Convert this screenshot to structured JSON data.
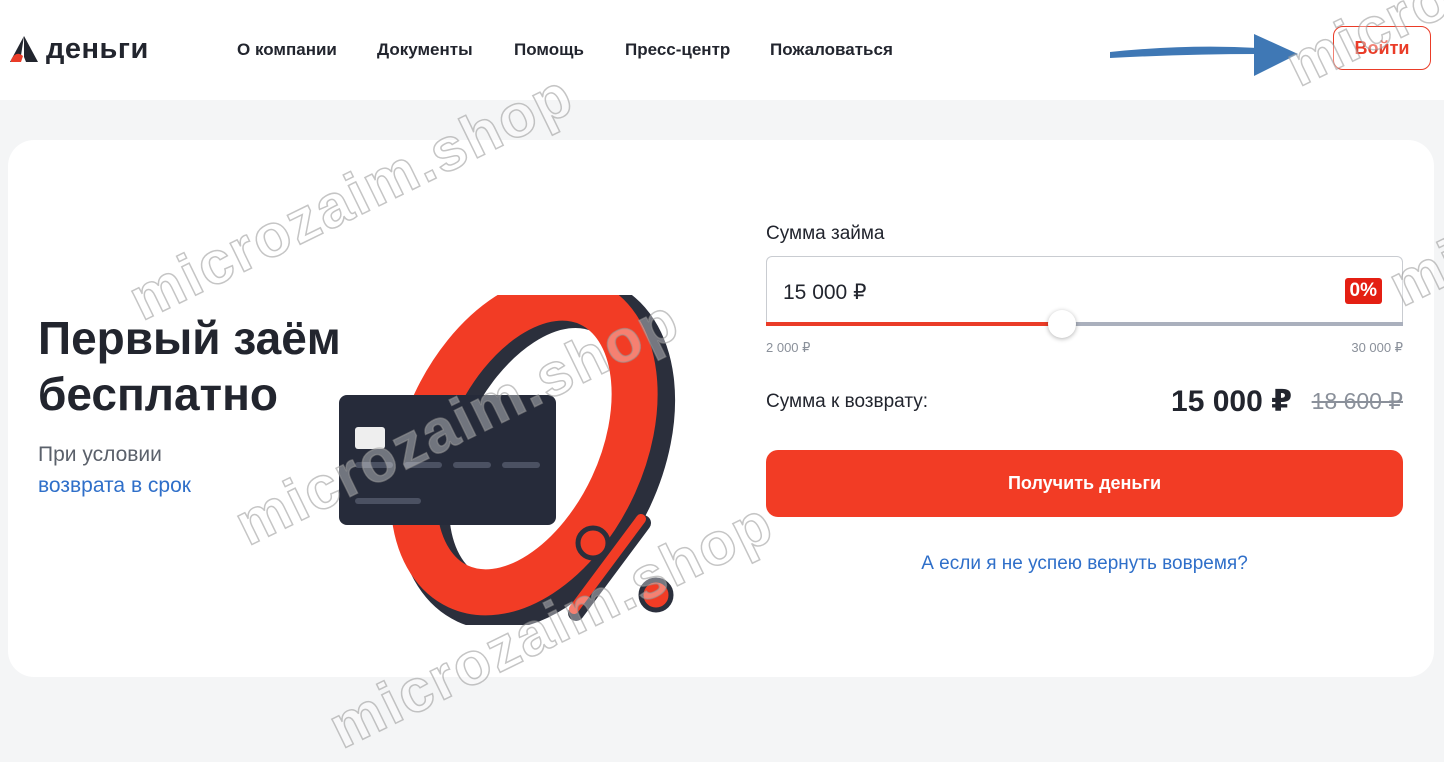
{
  "brand": {
    "name": "деньги",
    "accent_color": "#ea3c28",
    "link_color": "#2f6fc9"
  },
  "nav": {
    "items": [
      {
        "label": "О компании"
      },
      {
        "label": "Документы"
      },
      {
        "label": "Помощь"
      },
      {
        "label": "Пресс-центр"
      },
      {
        "label": "Пожаловаться"
      }
    ],
    "login_label": "Войти"
  },
  "hero": {
    "title": "Первый заём бесплатно",
    "subtitle_line1": "При условии",
    "subtitle_link": "возврата в срок",
    "illustration_badge": "%"
  },
  "calculator": {
    "label": "Сумма займа",
    "amount_value": "15 000 ₽",
    "rate_badge": "0%",
    "slider": {
      "min_label": "2 000 ₽",
      "max_label": "30 000 ₽",
      "min": 2000,
      "max": 30000,
      "value": 15000
    },
    "return_label": "Сумма к возврату:",
    "return_value": "15 000 ₽",
    "return_old_value": "18 600 ₽",
    "submit_label": "Получить деньги",
    "late_link": "А если я не успею вернуть вовремя?"
  },
  "watermark": {
    "text": "microzaim.shop"
  }
}
